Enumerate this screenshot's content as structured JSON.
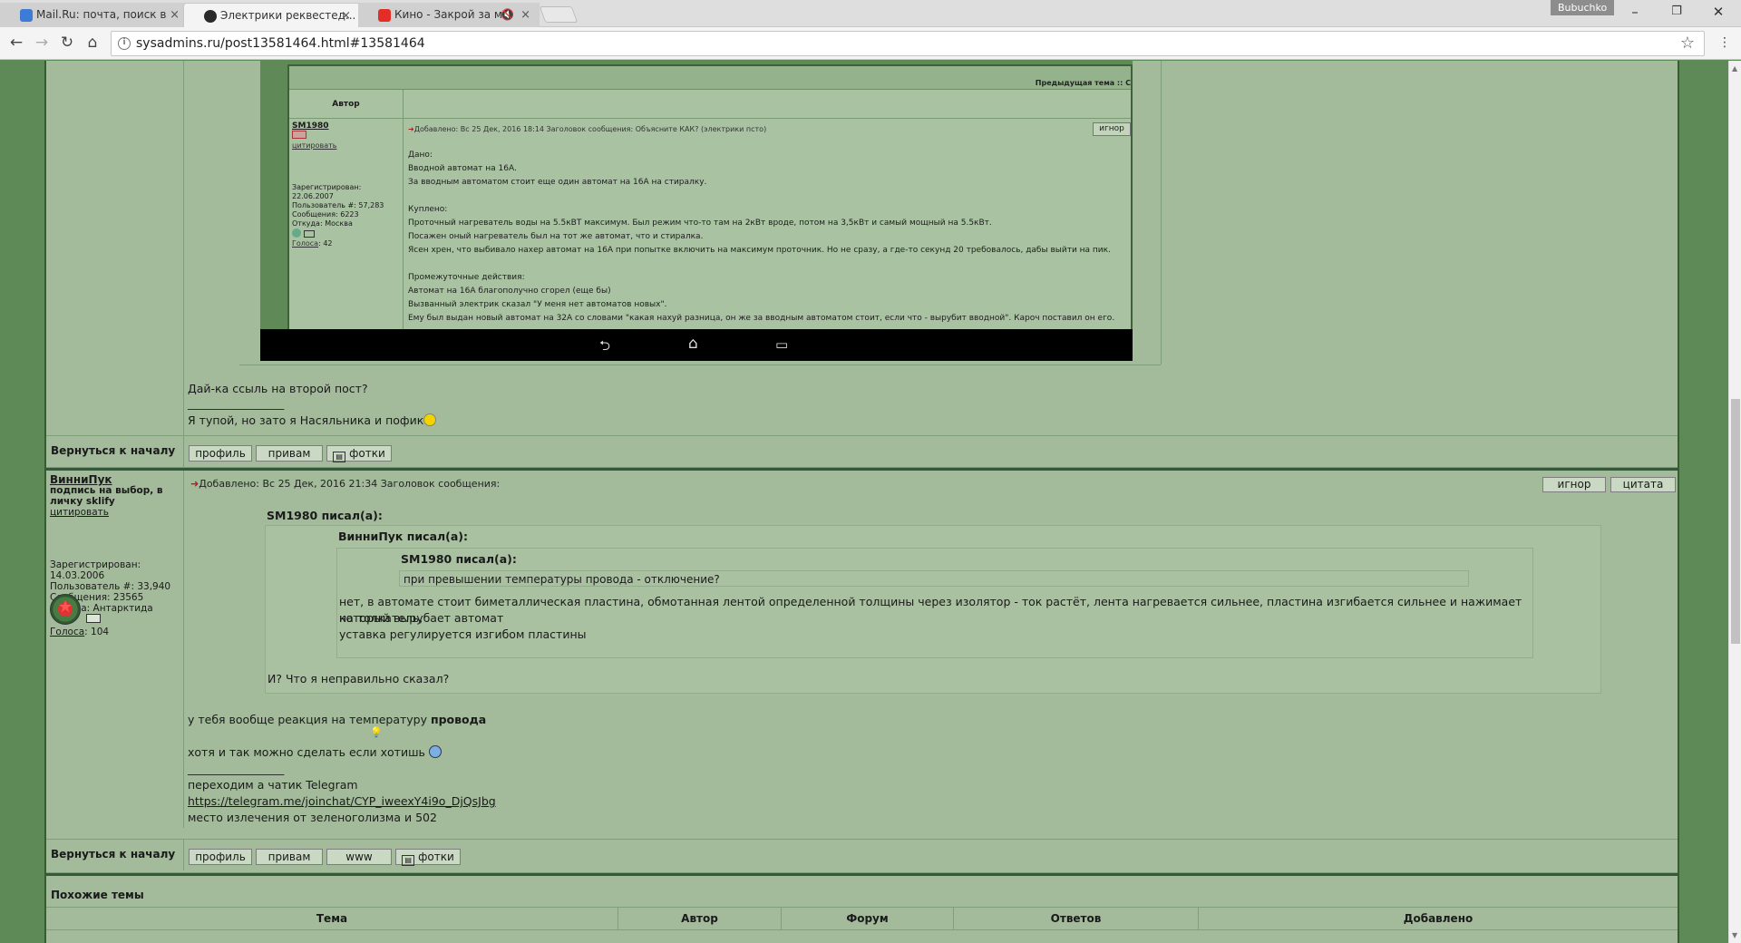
{
  "browser": {
    "tabs": [
      {
        "title": "Mail.Ru: почта, поиск в",
        "close": "×"
      },
      {
        "title": "Электрики реквестед...",
        "close": "×"
      },
      {
        "title": "Кино - Закрой за мн",
        "close": "×"
      }
    ],
    "profile": "Bubuchko",
    "url": "sysadmins.ru/post13581464.html#13581464",
    "controls": {
      "minimize": "–",
      "maximize": "❐",
      "close": "✕",
      "back": "←",
      "forward": "→",
      "reload": "↻",
      "home": "⌂",
      "star": "☆",
      "info": "i"
    }
  },
  "screenshot": {
    "prev_topic": "Предыдущая тема :: С",
    "author_header": "Автор",
    "username": "SM1980",
    "quote_link": "цитировать",
    "registered": "Зарегистрирован: 22.06.2007",
    "user_no": "Пользователь #: 57,283",
    "messages": "Сообщения: 6223",
    "from": "Откуда: Москва",
    "votes_label": "Голоса",
    "votes": ": 42",
    "meta": "Добавлено: Вс 25 Дек, 2016 18:14   Заголовок сообщения: Объясните КАК? (электрики псто)",
    "ignore": "игнор",
    "lines": [
      "Дано:",
      "Вводной автомат на 16А.",
      "За вводным автоматом стоит еще один автомат на 16А на стиралку.",
      "",
      "Куплено:",
      "Проточный нагреватель воды на 5.5кВТ максимум. Был режим что-то там на 2кВт вроде, потом на 3,5кВт и самый мощный на 5.5кВт.",
      "Посажен оный нагреватель был на тот же автомат, что и стиралка.",
      "Ясен хрен, что выбивало нахер автомат на 16А при попытке включить на максимум проточник. Но не сразу, а где-то секунд 20 требовалось, дабы выйти на пик.",
      "",
      "Промежуточные действия:",
      "Автомат на 16А благополучно сгорел (еще бы)",
      "Вызванный электрик сказал \"У меня нет автоматов новых\".",
      "Ему был выдан новый автомат на 32А со словами \"какая нахуй разница, он же за вводным автоматом стоит, если что - вырубит вводной\". Кароч поставил он его."
    ],
    "nav_icons": {
      "back": "⮌",
      "home": "⌂",
      "recent": "▭"
    }
  },
  "post1": {
    "text1": "Дай-ка ссыль на второй пост?",
    "sig_line": "_________________",
    "sig": "Я тупой, но зато я Насяльника и пофик",
    "back_to_top": "Вернуться к началу",
    "buttons": {
      "profile": "профиль",
      "pm": "привам",
      "photos": "фотки"
    }
  },
  "post2": {
    "username": "ВинниПук",
    "subtitle": "подпись на выбор, в личку sklify",
    "quote_link": "цитировать",
    "registered_label": "Зарегистрирован:",
    "registered": "14.03.2006",
    "user_no": "Пользователь #: 33,940",
    "messages": "Сообщения: 23565",
    "from": "Откуда: Антарктида",
    "votes_label": "Голоса",
    "votes": ": 104",
    "meta": "Добавлено: Вс 25 Дек, 2016 21:34    Заголовок сообщения:",
    "arrow": "➜",
    "ignore": "игнор",
    "quote": "цитата",
    "q1_title": "SM1980 писал(а):",
    "q2_title": "ВинниПук писал(а):",
    "q3_title": "SM1980 писал(а):",
    "q3_text": "при превышении температуры провода - отключение?",
    "q2_text1": "нет, в автомате стоит биметаллическая пластина, обмотанная лентой определенной толщины через изолятор - ток растёт, лента нагревается сильнее, пластина изгибается сильнее и нажимает на толкатель,",
    "q2_text2": "который вырубает автомат",
    "q2_text3": "уставка регулируется изгибом пластины",
    "q1_text": "И? Что я неправильно сказал?",
    "reply1_pre": "у тебя вообще реакция на температуру ",
    "reply1_bold": "провода",
    "reply2": "хотя и так можно сделать если хотишь",
    "sig_line": "_________________",
    "sig1": "переходим а чатик Telegram",
    "sig_link": "https://telegram.me/joinchat/CYP_iweexY4i9o_DjQsJbg",
    "sig2": "место излечения от зеленоголизма и 502",
    "back_to_top": "Вернуться к началу",
    "buttons": {
      "profile": "профиль",
      "pm": "привам",
      "www": "www",
      "photos": "фотки"
    }
  },
  "related": {
    "title": "Похожие темы",
    "columns": [
      "Тема",
      "Автор",
      "Форум",
      "Ответов",
      "Добавлено"
    ]
  },
  "colors": {
    "page_bg": "#5e8a57",
    "forum_bg": "#a3bb9b",
    "border": "#7f9f78"
  }
}
